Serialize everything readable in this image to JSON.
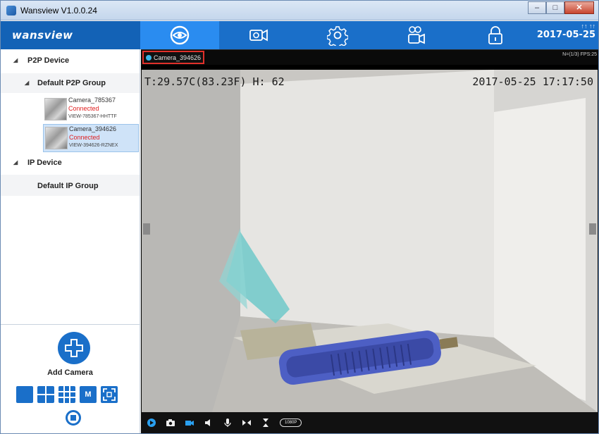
{
  "window": {
    "title": "Wansview  V1.0.0.24"
  },
  "brand": {
    "logo_text": "wansview"
  },
  "nav": {
    "items": [
      {
        "name": "live-view",
        "icon": "eye-icon",
        "active": true
      },
      {
        "name": "recording",
        "icon": "video-camera-icon"
      },
      {
        "name": "settings",
        "icon": "gear-icon"
      },
      {
        "name": "record-playback",
        "icon": "playback-camera-icon"
      },
      {
        "name": "lock",
        "icon": "lock-icon"
      }
    ],
    "status_small": "↑↑ ↑↑",
    "date": "2017-05-25"
  },
  "sidebar": {
    "p2p_device": "P2P Device",
    "default_p2p_group": "Default P2P Group",
    "cameras": [
      {
        "name": "Camera_785367",
        "status": "Connected",
        "uid": "VIEW-785367-HHTTF",
        "selected": false
      },
      {
        "name": "Camera_394626",
        "status": "Connected",
        "uid": "VIEW-394626-RZNEX",
        "selected": true
      }
    ],
    "ip_device": "IP Device",
    "default_ip_group": "Default IP Group",
    "add_camera": "Add Camera",
    "layout_m_label": "M"
  },
  "video": {
    "camera_tab": "Camera_394626",
    "fps_text": "N=(1/3) FPS:25",
    "osd_left": "T:29.57C(83.23F) H: 62",
    "osd_right": "2017-05-25 17:17:50",
    "resolution": "1080P"
  },
  "colors": {
    "accent": "#1a6fc9",
    "active_tab": "#2a8cf0",
    "status_red": "#e02020",
    "highlight": "#e0302a"
  }
}
